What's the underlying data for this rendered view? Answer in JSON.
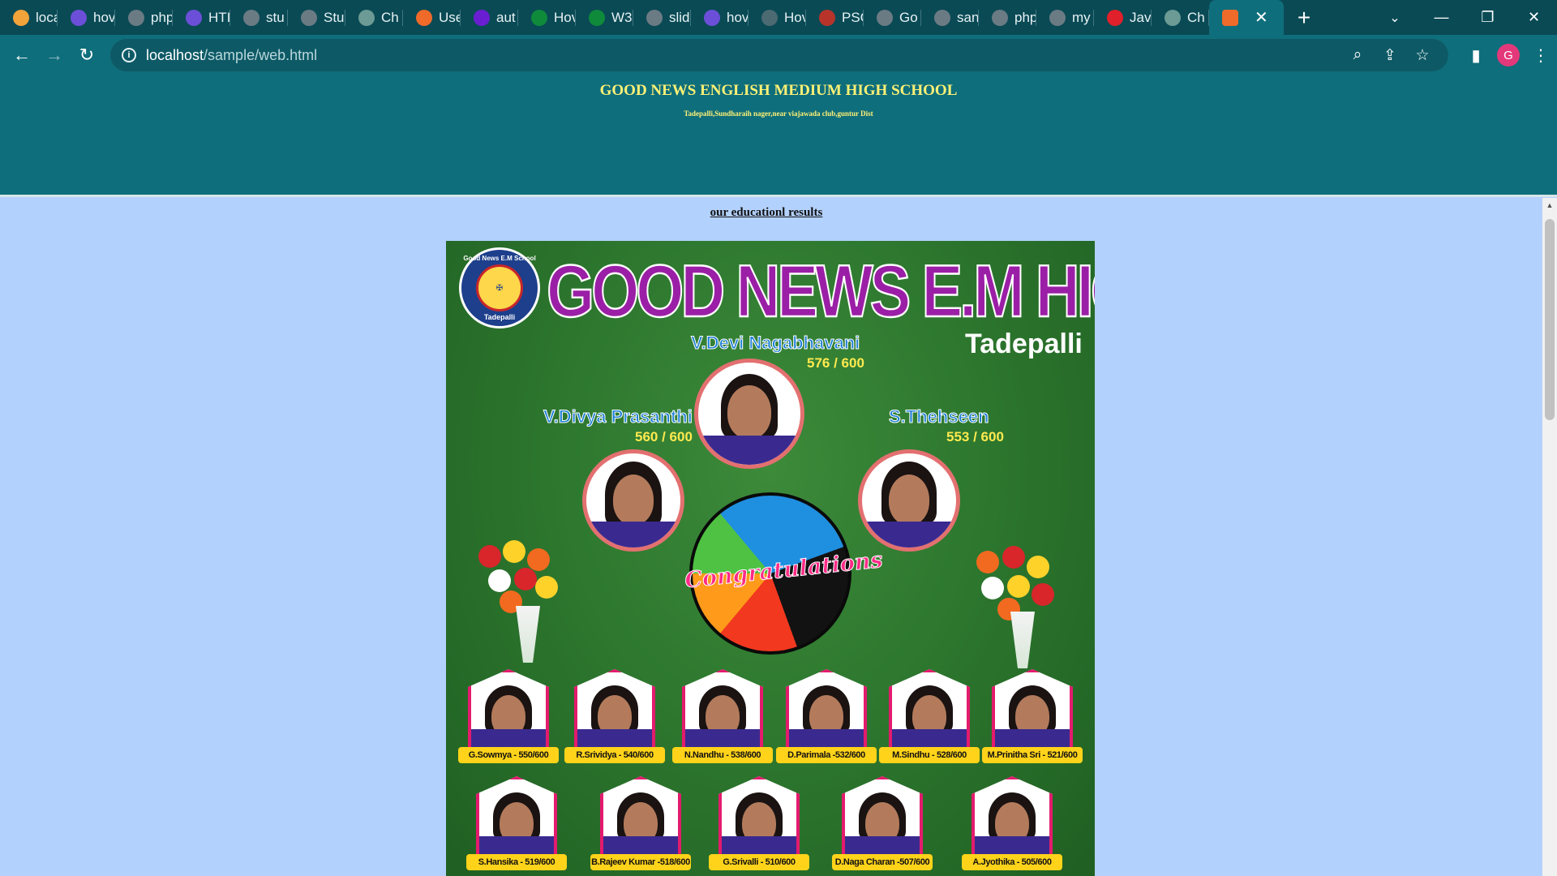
{
  "browser": {
    "tabs": [
      {
        "label": "loca",
        "icon": "tab-favicon",
        "color": "#f2a33a"
      },
      {
        "label": "hov",
        "icon": "tab-favicon",
        "color": "#6c4fd8"
      },
      {
        "label": "php",
        "icon": "tab-favicon",
        "color": "#6b7b84"
      },
      {
        "label": "HTI",
        "icon": "tab-favicon",
        "color": "#6c4fd8"
      },
      {
        "label": "stu",
        "icon": "globe-icon",
        "color": "#6b7b84"
      },
      {
        "label": "Stu",
        "icon": "globe-icon",
        "color": "#6b7b84"
      },
      {
        "label": "Ch",
        "icon": "tab-favicon",
        "color": "#6b9b94"
      },
      {
        "label": "Use",
        "icon": "tab-favicon",
        "color": "#f06a2a"
      },
      {
        "label": "aut",
        "icon": "tab-favicon",
        "color": "#6a1ed1"
      },
      {
        "label": "Hov",
        "icon": "tab-favicon",
        "color": "#0f8a3a"
      },
      {
        "label": "W3",
        "icon": "tab-favicon",
        "color": "#0f8a3a"
      },
      {
        "label": "slid",
        "icon": "globe-icon",
        "color": "#6b7b84"
      },
      {
        "label": "hov",
        "icon": "tab-favicon",
        "color": "#6c4fd8"
      },
      {
        "label": "Hov",
        "icon": "tab-favicon",
        "color": "#4c6a72"
      },
      {
        "label": "PSC",
        "icon": "tab-favicon",
        "color": "#b8342a"
      },
      {
        "label": "Go",
        "icon": "tab-favicon",
        "color": "#6b7b84"
      },
      {
        "label": "san",
        "icon": "tab-favicon",
        "color": "#6b7b84"
      },
      {
        "label": "php",
        "icon": "tab-favicon",
        "color": "#6b7b84"
      },
      {
        "label": "my",
        "icon": "tab-favicon",
        "color": "#6b7b84"
      },
      {
        "label": "Jav",
        "icon": "tab-favicon",
        "color": "#e0202a"
      },
      {
        "label": "Ch",
        "icon": "tab-favicon",
        "color": "#6b9b94"
      }
    ],
    "active_tab": {
      "label": "",
      "icon": "xampp-icon",
      "color": "#f06a2a"
    },
    "url_host": "localhost",
    "url_path": "/sample/web.html",
    "profile_initial": "G"
  },
  "page": {
    "header_title": "GOOD NEWS ENGLISH MEDIUM HIGH SCHOOL",
    "header_address": "Tadepalli,Sundharaih nager,near viajawada club,guntur Dist",
    "results_link": "our educationl results"
  },
  "poster": {
    "title": "GOOD NEWS E.M HIGH SCHOOL",
    "place": "Tadepalli",
    "logo_top": "Good News E.M School",
    "logo_bottom": "Tadepalli",
    "congrats": "Congratulations",
    "toppers": [
      {
        "name": "V.Devi Nagabhavani",
        "score": "576 / 600"
      },
      {
        "name": "V.Divya Prasanthi",
        "score": "560 / 600"
      },
      {
        "name": "S.Thehseen",
        "score": "553 / 600"
      }
    ],
    "row1": [
      "G.Sowmya - 550/600",
      "R.Srividya - 540/600",
      "N.Nandhu - 538/600",
      "D.Parimala -532/600",
      "M.Sindhu - 528/600",
      "M.Prinitha Sri - 521/600"
    ],
    "row2": [
      "S.Hansika - 519/600",
      "B.Rajeev Kumar -518/600",
      "G.Srivalli - 510/600",
      "D.Naga Charan -507/600",
      "A.Jyothika - 505/600"
    ]
  }
}
